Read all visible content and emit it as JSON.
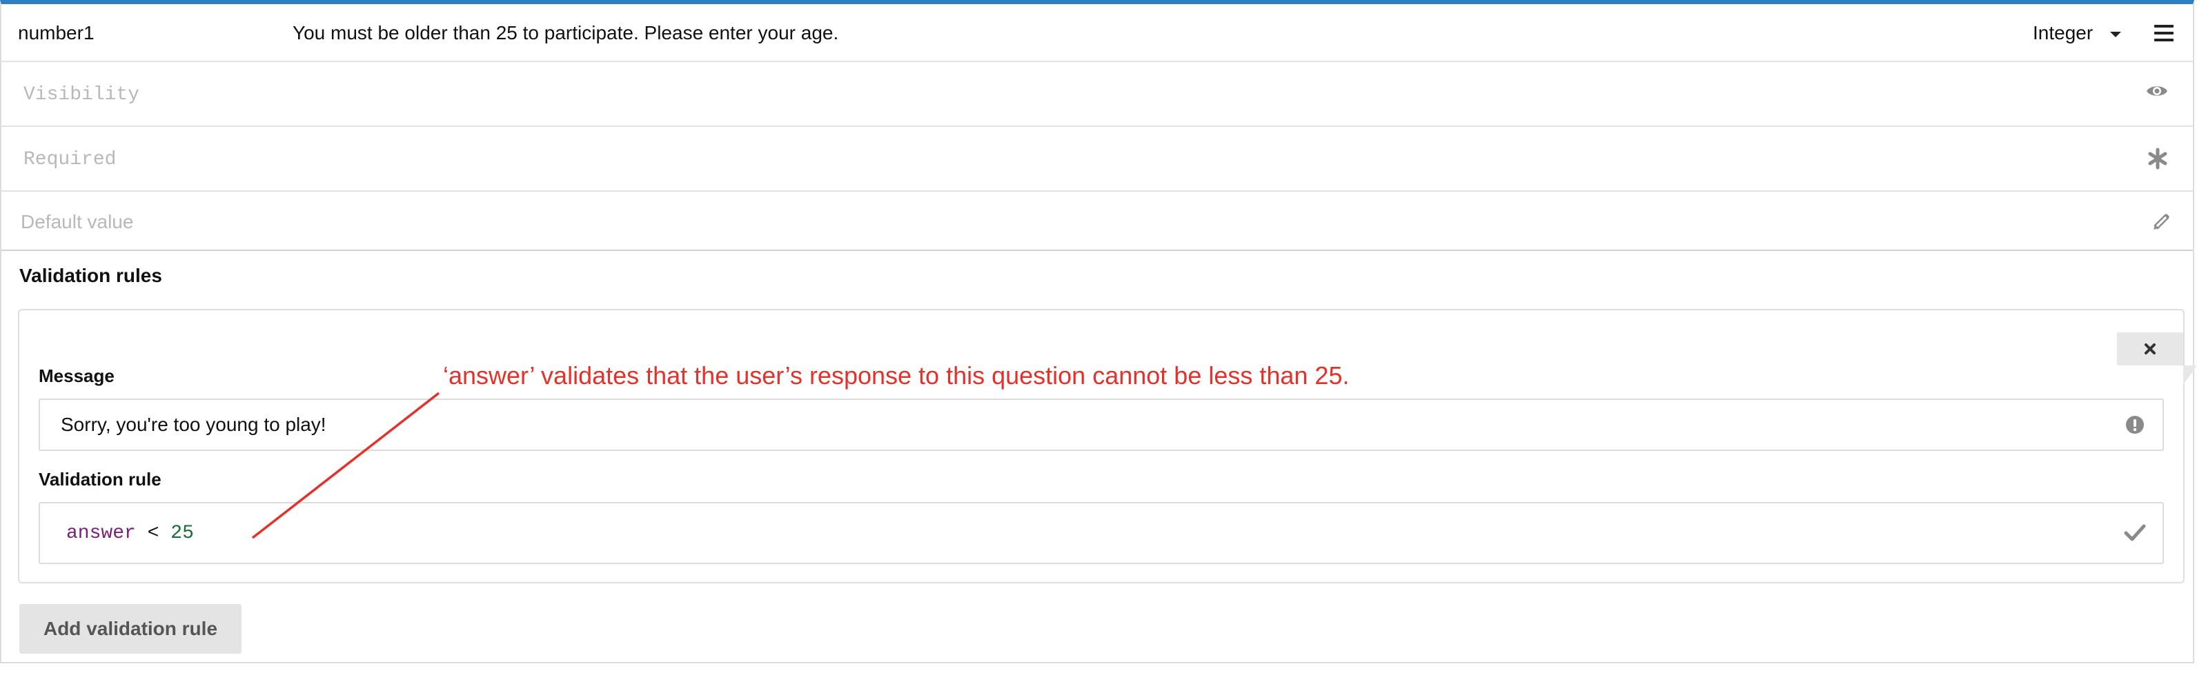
{
  "question": {
    "name": "number1",
    "label": "You must be older than 25 to participate. Please enter your age.",
    "type": "Integer"
  },
  "settings": {
    "visibility_placeholder": "Visibility",
    "required_placeholder": "Required",
    "default_value_placeholder": "Default value"
  },
  "validation": {
    "section_title": "Validation rules",
    "rules": [
      {
        "message_label": "Message",
        "message_value": "Sorry, you're too young to play!",
        "rule_label": "Validation rule",
        "rule_tokens": [
          "answer",
          "<",
          "25"
        ]
      }
    ],
    "add_button_label": "Add validation rule"
  },
  "annotation": {
    "text": "‘answer’ validates that the user’s response to this question cannot be less than 25.",
    "color": "#e4312a"
  },
  "colors": {
    "accent_top_border": "#2d7fc1",
    "annotation": "#e4312a"
  },
  "icons": [
    "menu-icon",
    "eye-icon",
    "asterisk-icon",
    "pencil-icon",
    "close-icon",
    "exclamation-circle-icon",
    "checkmark-icon",
    "caret-down-icon"
  ]
}
